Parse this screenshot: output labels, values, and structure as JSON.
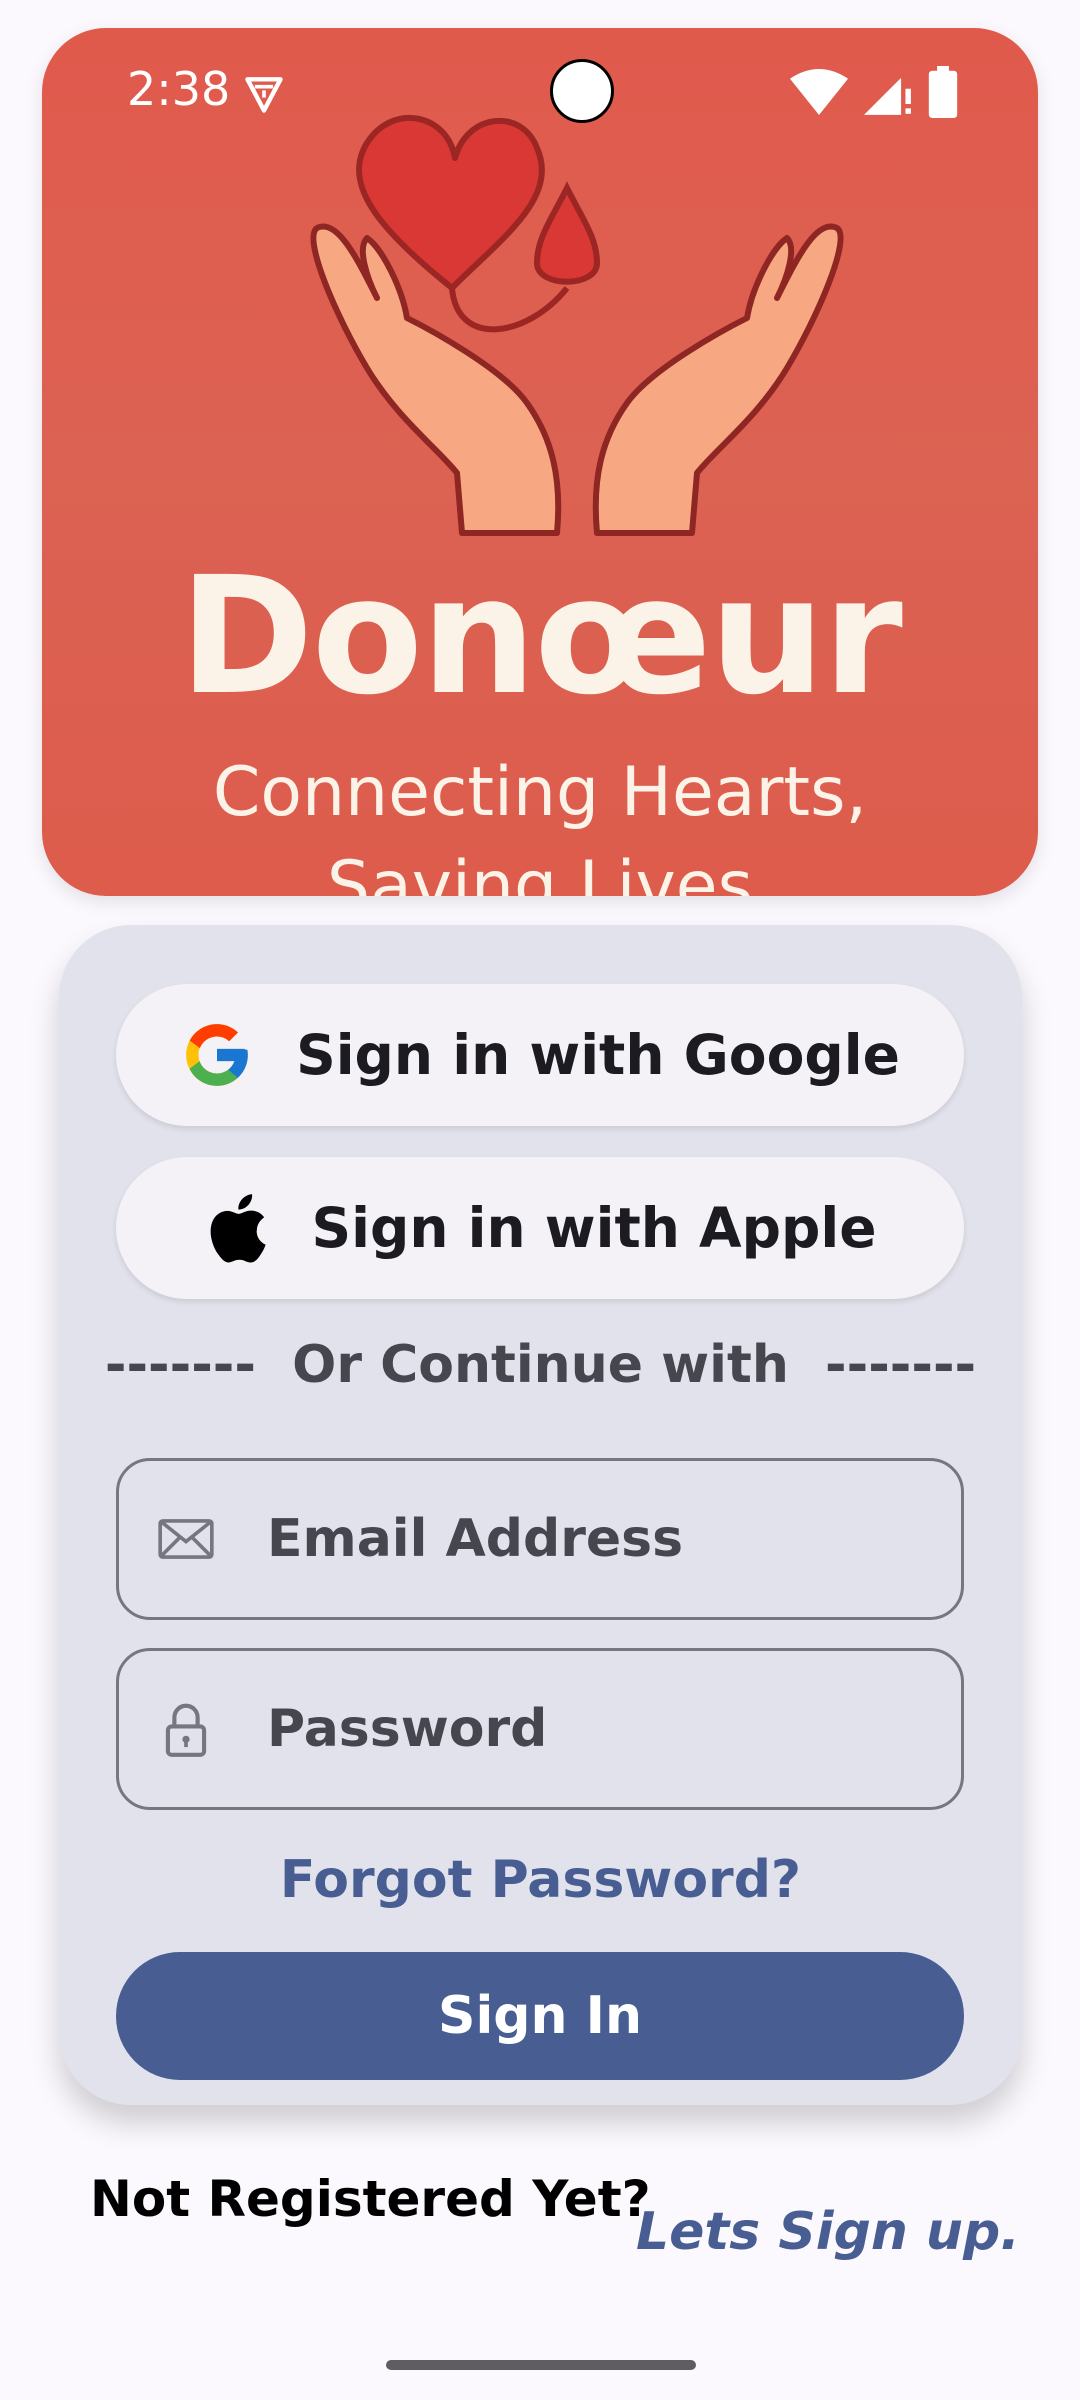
{
  "status_bar": {
    "time": "2:38",
    "icons": [
      "shield-alert-icon",
      "wifi-icon",
      "cell-signal-icon",
      "battery-icon"
    ]
  },
  "hero": {
    "app_name": "Donœur",
    "tagline_line1": "Connecting Hearts,",
    "tagline_line2": "Saving Lives",
    "logo": "hands-holding-heart-and-blood-drop",
    "background_color": "#dd5c4c"
  },
  "login": {
    "google_label": "Sign in with Google",
    "apple_label": "Sign in with Apple",
    "divider_label": "-------  Or Continue with  -------",
    "email_placeholder": "Email Address",
    "password_placeholder": "Password",
    "forgot_label": "Forgot Password?",
    "signin_label": "Sign In"
  },
  "footer": {
    "not_registered": "Not Registered Yet?",
    "signup_label": "Lets Sign up."
  },
  "colors": {
    "accent": "#485d92",
    "card_background": "#e2e2ec",
    "page_background": "#fbf9fd"
  }
}
